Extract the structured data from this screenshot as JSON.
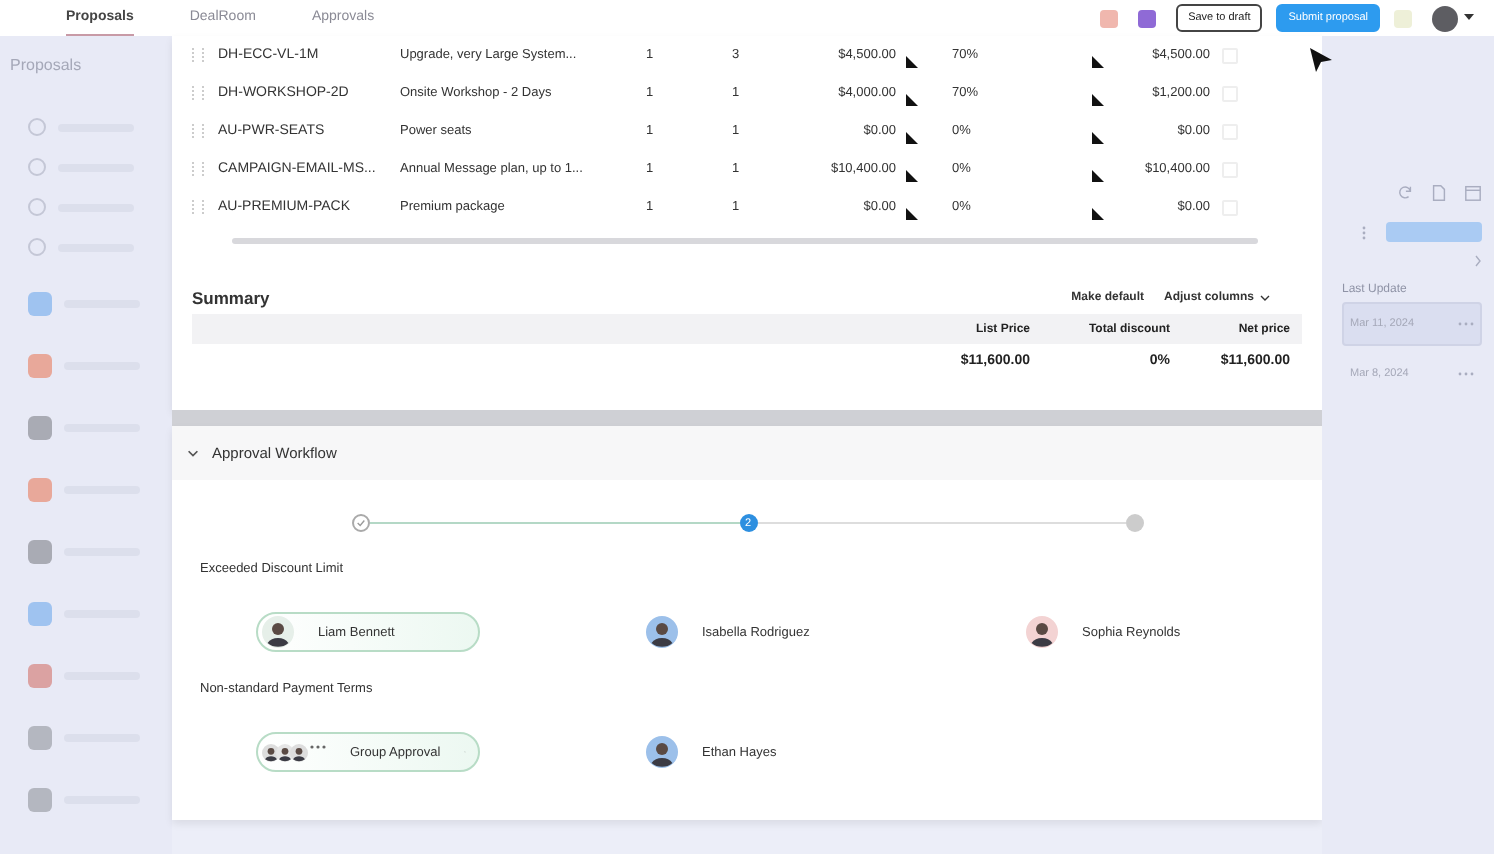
{
  "top_bar": {
    "tabs": [
      {
        "label": "Proposals",
        "selected": true
      },
      {
        "label": "DealRoom",
        "selected": false
      },
      {
        "label": "Approvals",
        "selected": false
      }
    ],
    "buttons": [
      {
        "label": "Save to draft",
        "kind": "outline"
      },
      {
        "label": "Submit proposal",
        "kind": "primary"
      }
    ]
  },
  "left_sidebar": {
    "title": "Proposals",
    "apps": [
      {
        "color": "#9fc3f0"
      },
      {
        "color": "#e8a89a"
      },
      {
        "color": "#a9abb4"
      },
      {
        "color": "#e8a89a"
      },
      {
        "color": "#a9abb4"
      },
      {
        "color": "#9fc3f0"
      },
      {
        "color": "#dba2a2"
      },
      {
        "color": "#b4b7c0"
      },
      {
        "color": "#b4b7c0"
      }
    ]
  },
  "line_items": {
    "rows": [
      {
        "code": "DH-ECC-VL-1M",
        "description": "Upgrade, very Large System...",
        "column_3": "1",
        "column_4": "3",
        "list_price": "$4,500.00",
        "discount": "70%",
        "net_price": "$4,500.00"
      },
      {
        "code": "DH-WORKSHOP-2D",
        "description": "Onsite Workshop - 2 Days",
        "column_3": "1",
        "column_4": "1",
        "list_price": "$4,000.00",
        "discount": "70%",
        "net_price": "$1,200.00"
      },
      {
        "code": "AU-PWR-SEATS",
        "description": "Power seats",
        "column_3": "1",
        "column_4": "1",
        "list_price": "$0.00",
        "discount": "0%",
        "net_price": "$0.00"
      },
      {
        "code": "CAMPAIGN-EMAIL-MS...",
        "description": "Annual Message plan, up to 1...",
        "column_3": "1",
        "column_4": "1",
        "list_price": "$10,400.00",
        "discount": "0%",
        "net_price": "$10,400.00"
      },
      {
        "code": "AU-PREMIUM-PACK",
        "description": "Premium package",
        "column_3": "1",
        "column_4": "1",
        "list_price": "$0.00",
        "discount": "0%",
        "net_price": "$0.00"
      }
    ]
  },
  "summary": {
    "title": "Summary",
    "actions": [
      "Make default",
      "Adjust columns"
    ],
    "columns": [
      "List Price",
      "Total discount",
      "Net price"
    ],
    "values": [
      "$11,600.00",
      "0%",
      "$11,600.00"
    ]
  },
  "approval_workflow": {
    "title": "Approval Workflow",
    "expanded": true,
    "steps": [
      {
        "completed": true
      },
      {
        "completed": false,
        "label": "2"
      },
      {
        "completed": false
      }
    ],
    "groups": [
      {
        "title": "Exceeded Discount Limit",
        "approvers": [
          {
            "kind": "person",
            "name": "Liam Bennett",
            "selected": true
          },
          {
            "kind": "person",
            "name": "Isabella Rodriguez",
            "selected": false
          },
          {
            "kind": "person",
            "name": "Sophia Reynolds",
            "selected": false
          }
        ]
      },
      {
        "title": "Non-standard Payment Terms",
        "approvers": [
          {
            "kind": "group",
            "name": "Group Approval",
            "selected": true
          },
          {
            "kind": "person",
            "name": "Ethan Hayes",
            "selected": false
          }
        ]
      }
    ]
  },
  "right_sidebar": {
    "heading": "Last Update",
    "dates": [
      {
        "text": "Mar 11, 2024",
        "selected": true
      },
      {
        "text": "Mar 8, 2024",
        "selected": false
      }
    ]
  }
}
